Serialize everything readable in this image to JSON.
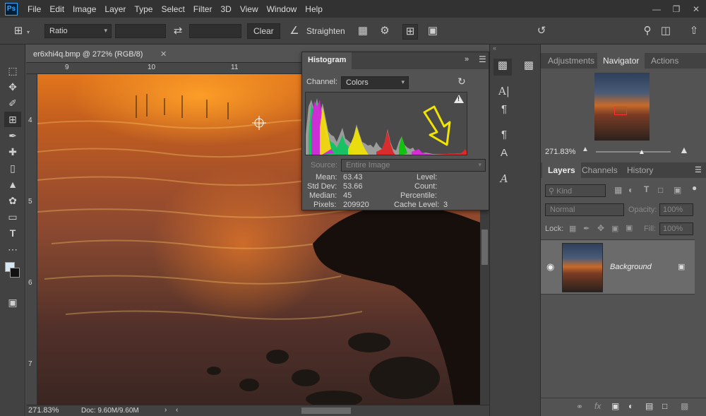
{
  "menubar": {
    "logo": "Ps",
    "items": [
      "File",
      "Edit",
      "Image",
      "Layer",
      "Type",
      "Select",
      "Filter",
      "3D",
      "View",
      "Window",
      "Help"
    ]
  },
  "options": {
    "ratio": "Ratio",
    "clear": "Clear",
    "straighten": "Straighten"
  },
  "document": {
    "tab_title": "er6xhi4q.bmp @ 272% (RGB/8)",
    "ruler_h": [
      "9",
      "10",
      "11"
    ],
    "ruler_v": [
      "4",
      "5",
      "6",
      "7"
    ],
    "zoom": "271.83%",
    "doc_size": "Doc: 9.60M/9.60M"
  },
  "histogram": {
    "title": "Histogram",
    "channel_label": "Channel:",
    "channel_value": "Colors",
    "source_label": "Source:",
    "source_value": "Entire Image",
    "stats": {
      "mean_label": "Mean:",
      "mean": "63.43",
      "stddev_label": "Std Dev:",
      "stddev": "53.66",
      "median_label": "Median:",
      "median": "45",
      "pixels_label": "Pixels:",
      "pixels": "209920",
      "level_label": "Level:",
      "count_label": "Count:",
      "percentile_label": "Percentile:",
      "cache_label": "Cache Level:",
      "cache": "3"
    },
    "warning": "!"
  },
  "right_panels": {
    "top_tabs": [
      "Adjustments",
      "Navigator",
      "Actions"
    ],
    "nav_zoom": "271.83%",
    "layer_tabs": [
      "Layers",
      "Channels",
      "History"
    ],
    "kind_placeholder": "Kind",
    "blend_mode": "Normal",
    "opacity_label": "Opacity:",
    "opacity_value": "100%",
    "lock_label": "Lock:",
    "fill_label": "Fill:",
    "fill_value": "100%",
    "layer_name": "Background"
  },
  "colors": {
    "app_bg": "#535353",
    "panel": "#424242",
    "menubar": "#323232",
    "accent_arrow": "#f2e400"
  }
}
